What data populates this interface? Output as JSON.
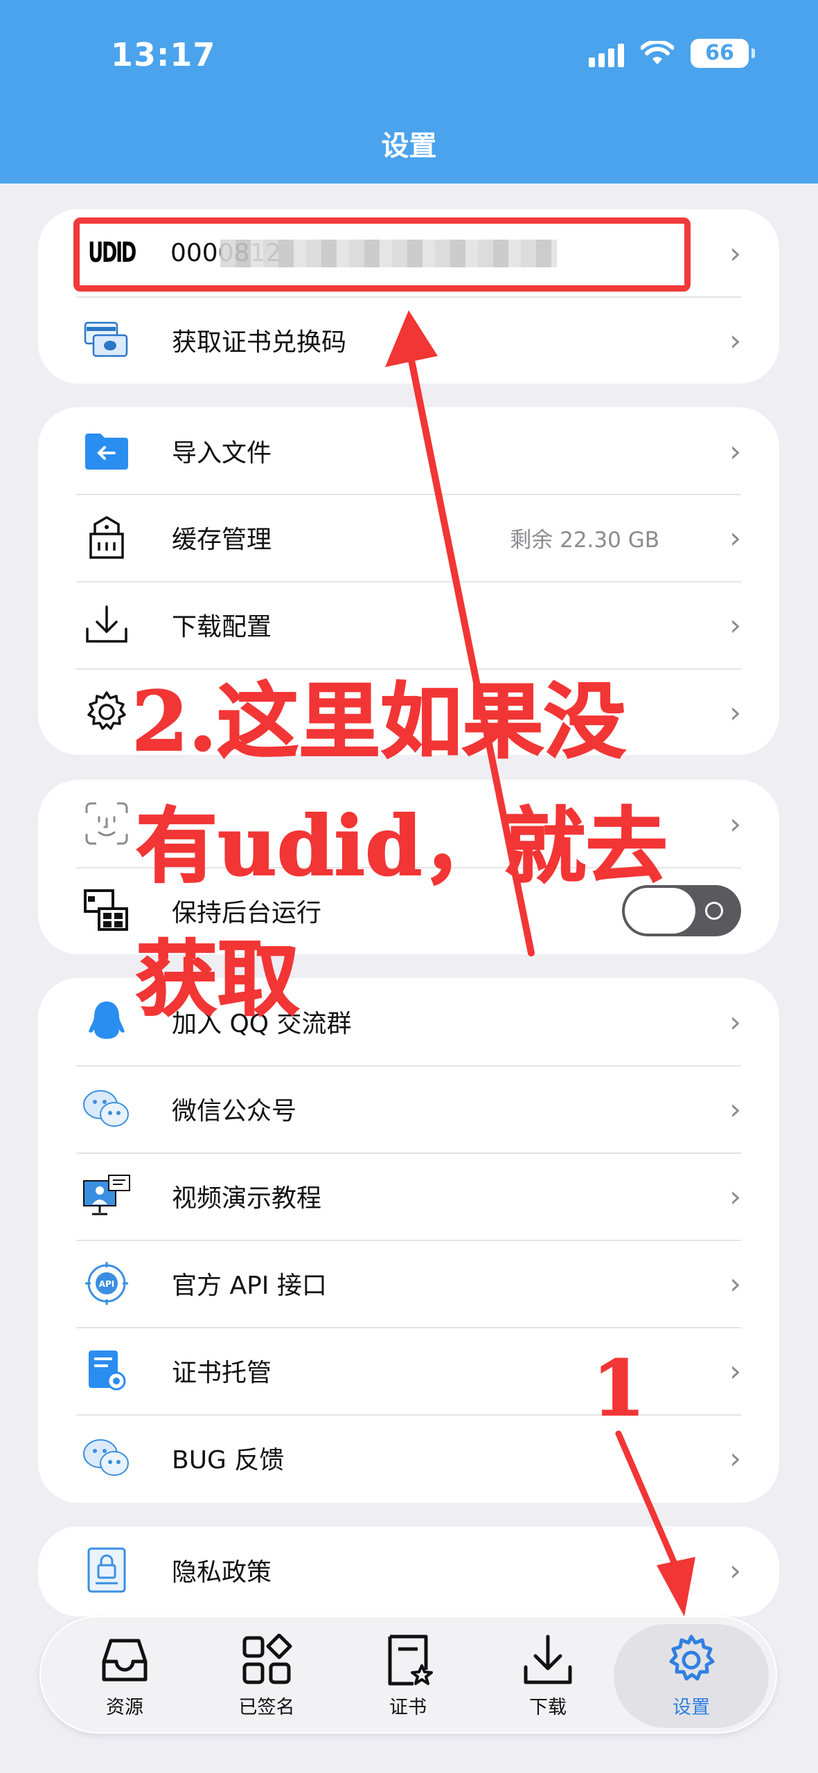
{
  "status": {
    "time": "13:17",
    "battery": "66"
  },
  "header": {
    "title": "设置"
  },
  "udid": {
    "badge": "UDID",
    "value_prefix": "0000812"
  },
  "groups": {
    "g1": [
      {
        "label": "获取证书兑换码"
      }
    ],
    "g2": [
      {
        "label": "导入文件"
      },
      {
        "label": "缓存管理",
        "value": "剩余 22.30 GB"
      },
      {
        "label": "下载配置"
      }
    ],
    "g3": [
      {
        "label": "保持后台运行"
      }
    ],
    "g4": [
      {
        "label": "加入 QQ 交流群"
      },
      {
        "label": "微信公众号"
      },
      {
        "label": "视频演示教程"
      },
      {
        "label": "官方 API 接口"
      },
      {
        "label": "证书托管"
      },
      {
        "label": "BUG 反馈"
      }
    ],
    "g5": [
      {
        "label": "隐私政策"
      }
    ]
  },
  "annotations": {
    "step2_line1": "2.这里如果没",
    "step2_line2": "有udid，就去",
    "step2_line3": "获取",
    "step1": "1"
  },
  "tabs": [
    {
      "label": "资源",
      "icon": "inbox-icon"
    },
    {
      "label": "已签名",
      "icon": "apps-grid-icon"
    },
    {
      "label": "证书",
      "icon": "certificate-icon"
    },
    {
      "label": "下载",
      "icon": "download-icon"
    },
    {
      "label": "设置",
      "icon": "gear-icon",
      "active": true
    }
  ],
  "colors": {
    "header": "#4aa3ec",
    "annotation": "#f23535",
    "active_tab": "#2f7fe0"
  }
}
